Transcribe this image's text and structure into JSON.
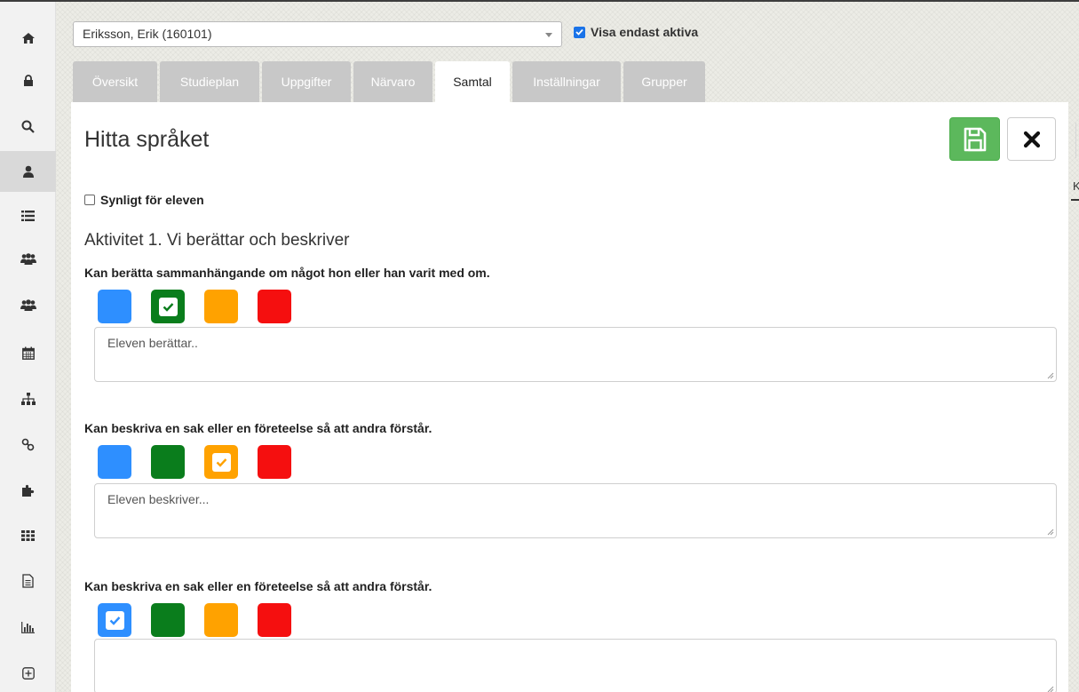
{
  "header": {
    "student_select": "Eriksson, Erik (160101)",
    "show_only_active_label": "Visa endast aktiva",
    "show_only_active_checked": true
  },
  "tabs": [
    {
      "label": "Översikt",
      "active": false
    },
    {
      "label": "Studieplan",
      "active": false
    },
    {
      "label": "Uppgifter",
      "active": false
    },
    {
      "label": "Närvaro",
      "active": false
    },
    {
      "label": "Samtal",
      "active": true
    },
    {
      "label": "Inställningar",
      "active": false
    },
    {
      "label": "Grupper",
      "active": false
    }
  ],
  "sidebar": {
    "items": [
      {
        "icon": "home-icon"
      },
      {
        "icon": "lock-icon"
      },
      {
        "icon": "search-icon"
      },
      {
        "icon": "user-icon",
        "active": true
      },
      {
        "icon": "list-icon"
      },
      {
        "icon": "group-icon"
      },
      {
        "icon": "group-icon-2"
      },
      {
        "icon": "calendar-icon"
      },
      {
        "icon": "sitemap-icon"
      },
      {
        "icon": "link-icon"
      },
      {
        "icon": "puzzle-icon"
      },
      {
        "icon": "grid-icon"
      },
      {
        "icon": "document-icon"
      },
      {
        "icon": "bar-chart-icon"
      },
      {
        "icon": "plus-square-icon"
      }
    ]
  },
  "main": {
    "title": "Hitta språket",
    "visible_for_student_label": "Synligt för eleven",
    "visible_for_student_checked": false,
    "activity_title": "Aktivitet 1. Vi berättar och beskriver",
    "edge_label": "K",
    "criteria": [
      {
        "text": "Kan berätta sammanhängande om något hon eller han varit med om.",
        "selected": "green",
        "note_placeholder": "Eleven berättar.."
      },
      {
        "text": "Kan beskriva en sak eller en företeelse så att andra förstår.",
        "selected": "orange",
        "note_placeholder": "Eleven beskriver..."
      },
      {
        "text": "Kan beskriva en sak eller en företeelse så att andra förstår.",
        "selected": "blue",
        "note_placeholder": ""
      }
    ]
  },
  "colors": {
    "blue": "#2e8fff",
    "green": "#0a7d1c",
    "orange": "#ffa200",
    "red": "#f50f0f",
    "save_button": "#5cb85c"
  }
}
